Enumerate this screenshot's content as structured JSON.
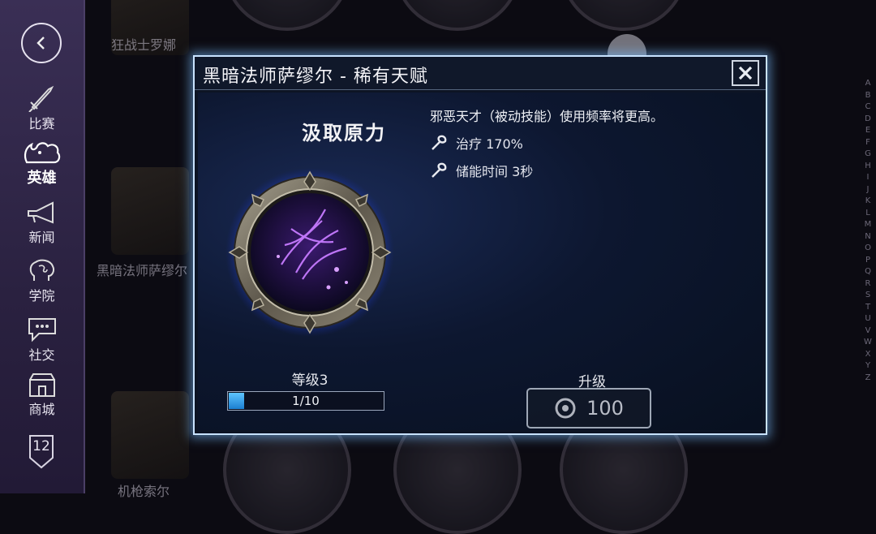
{
  "sidebar": {
    "back_icon": "chevron-left-icon",
    "items": [
      {
        "label": "比赛",
        "icon": "sword-icon",
        "active": false
      },
      {
        "label": "英雄",
        "icon": "hero-icon",
        "active": true
      },
      {
        "label": "新闻",
        "icon": "horn-icon",
        "active": false
      },
      {
        "label": "学院",
        "icon": "brain-icon",
        "active": false
      },
      {
        "label": "社交",
        "icon": "chat-icon",
        "active": false
      },
      {
        "label": "商城",
        "icon": "shop-icon",
        "active": false
      }
    ],
    "level_badge": "12"
  },
  "background": {
    "hero_names": [
      "狂战士罗娜",
      "黑暗法师萨缪尔",
      "机枪索尔"
    ],
    "alphabet": [
      "A",
      "B",
      "C",
      "D",
      "E",
      "F",
      "G",
      "H",
      "I",
      "J",
      "K",
      "L",
      "M",
      "N",
      "O",
      "P",
      "Q",
      "R",
      "S",
      "T",
      "U",
      "V",
      "W",
      "X",
      "Y",
      "Z"
    ]
  },
  "dialog": {
    "title": "黑暗法师萨缪尔 - 稀有天赋",
    "close_icon": "close-icon",
    "skill_name": "汲取原力",
    "description": "邪恶天才（被动技能）使用频率将更高。",
    "stats": [
      {
        "icon": "wrench-icon",
        "text": "治疗 170%"
      },
      {
        "icon": "wrench-icon",
        "text": "储能时间 3秒"
      }
    ],
    "level_label": "等级3",
    "progress": {
      "text": "1/10",
      "fraction": 0.1
    },
    "upgrade_label": "升级",
    "upgrade_cost": "100",
    "currency_icon": "coin-icon"
  },
  "colors": {
    "accent": "#c9e3ff",
    "progress_fill": "#3aa8f0",
    "sidebar": "#2e2545"
  }
}
